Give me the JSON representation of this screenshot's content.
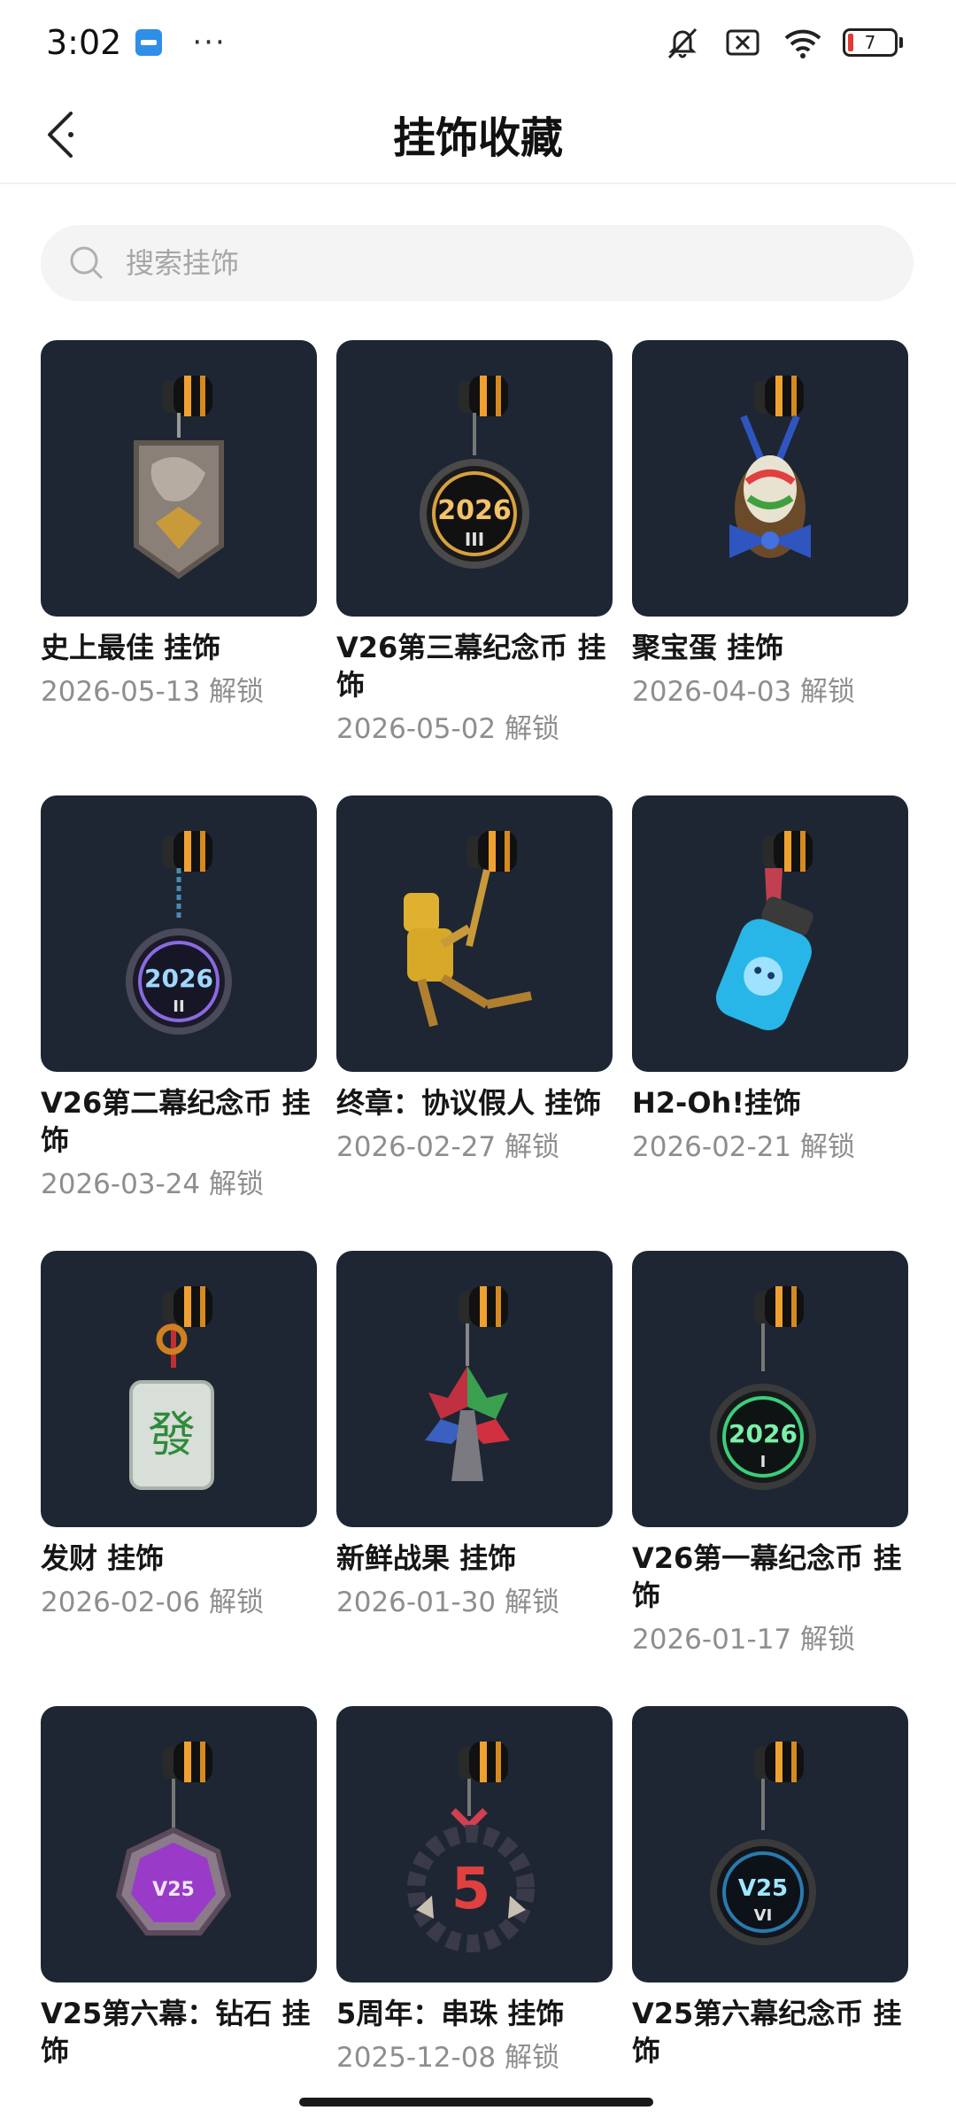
{
  "status_bar": {
    "time": "3:02",
    "more": "···",
    "battery": "7"
  },
  "nav": {
    "title": "挂饰收藏"
  },
  "search": {
    "placeholder": "搜索挂饰"
  },
  "items": [
    {
      "name": "史上最佳 挂饰",
      "date": "2026-05-13 解锁",
      "icon": "medal-charm-icon"
    },
    {
      "name": "V26第三幕纪念币 挂饰",
      "date": "2026-05-02 解锁",
      "icon": "coin-2026-iii-charm-icon",
      "coin_text": "2026",
      "coin_sub": "III"
    },
    {
      "name": "聚宝蛋 挂饰",
      "date": "2026-04-03 解锁",
      "icon": "egg-basket-charm-icon"
    },
    {
      "name": "V26第二幕纪念币 挂饰",
      "date": "2026-03-24 解锁",
      "icon": "coin-2026-ii-charm-icon",
      "coin_text": "2026",
      "coin_sub": "II"
    },
    {
      "name": "终章：协议假人 挂饰",
      "date": "2026-02-27 解锁",
      "icon": "dummy-figure-charm-icon"
    },
    {
      "name": "H2-Oh!挂饰",
      "date": "2026-02-21 解锁",
      "icon": "water-bottle-charm-icon"
    },
    {
      "name": "发财 挂饰",
      "date": "2026-02-06 解锁",
      "icon": "mahjong-tile-charm-icon",
      "tile_text": "發"
    },
    {
      "name": "新鲜战果 挂饰",
      "date": "2026-01-30 解锁",
      "icon": "leaf-tree-charm-icon"
    },
    {
      "name": "V26第一幕纪念币 挂饰",
      "date": "2026-01-17 解锁",
      "icon": "coin-2026-i-charm-icon",
      "coin_text": "2026",
      "coin_sub": "I"
    },
    {
      "name": "V25第六幕：钻石 挂饰",
      "date": "",
      "icon": "diamond-v25-charm-icon",
      "coin_text": "V25"
    },
    {
      "name": "5周年：串珠 挂饰",
      "date": "2025-12-08 解锁",
      "icon": "bead-ring-5-charm-icon",
      "coin_text": "5"
    },
    {
      "name": "V25第六幕纪念币 挂饰",
      "date": "",
      "icon": "coin-v25-vi-charm-icon",
      "coin_text": "V25",
      "coin_sub": "VI"
    }
  ],
  "colors": {
    "card_bg": "#1e2633",
    "gold": "#e0a030",
    "title_text": "#161616",
    "date_text": "#8e8e8e"
  }
}
